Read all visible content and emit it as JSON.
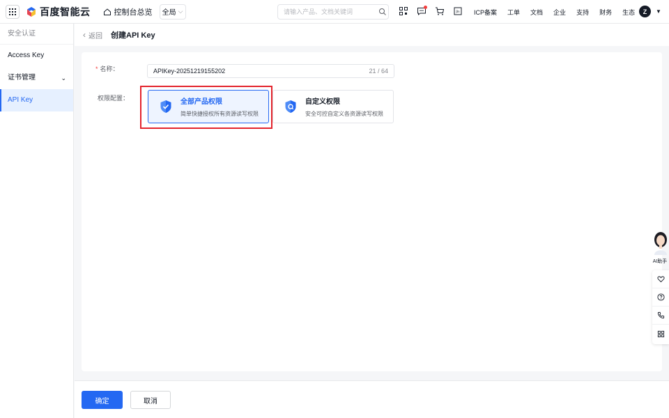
{
  "brand": {
    "logo_text": "百度智能云"
  },
  "topbar": {
    "console_label": "控制台总览",
    "region_label": "全局",
    "search_placeholder": "请输入产品、文档关键词",
    "nav_links": [
      "ICP备案",
      "工单",
      "文档",
      "企业",
      "支持",
      "财务",
      "生态"
    ],
    "avatar_letter": "Z",
    "icons": [
      "qrcode-icon",
      "message-icon",
      "cart-icon",
      "beta-icon"
    ]
  },
  "sidebar": {
    "title": "安全认证",
    "items": [
      {
        "label": "Access Key",
        "active": false
      },
      {
        "label": "证书管理",
        "active": false,
        "has_chevron": true
      },
      {
        "label": "API Key",
        "active": true
      }
    ]
  },
  "header": {
    "back_label": "返回",
    "title": "创建API Key"
  },
  "form": {
    "name_label": "名称：",
    "name_value": "APIKey-20251219155202",
    "name_count": "21 / 64",
    "perm_label": "权限配置：",
    "options": [
      {
        "title": "全部产品权限",
        "desc": "简单快捷授权所有资源读写权限",
        "selected": true
      },
      {
        "title": "自定义权限",
        "desc": "安全可控自定义各资源读写权限",
        "selected": false
      }
    ]
  },
  "footer": {
    "ok_label": "确定",
    "cancel_label": "取消"
  },
  "assistant": {
    "label": "AI助手"
  },
  "colors": {
    "primary": "#2468f2",
    "highlight": "#e3232c",
    "required": "#f33e3e"
  }
}
